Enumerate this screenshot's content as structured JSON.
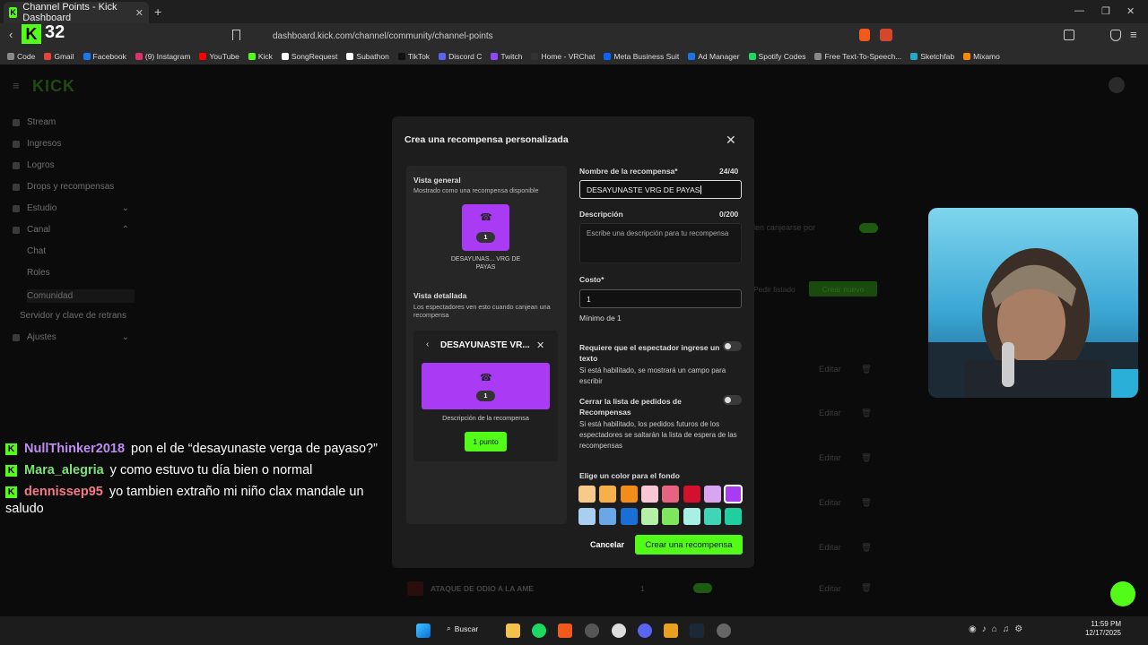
{
  "browser": {
    "tab_title": "Channel Points - Kick Dashboard",
    "url": "dashboard.kick.com/channel/community/channel-points",
    "kick_count": "32",
    "bookmarks": [
      "Code",
      "Gmail",
      "Facebook",
      "(9) Instagram",
      "YouTube",
      "Kick",
      "SongRequest",
      "Subathon",
      "TikTok",
      "Discord C",
      "Twitch",
      "Home - VRChat",
      "Meta Business Suit",
      "Ad Manager",
      "Spotify Codes",
      "Free Text-To-Speech...",
      "Sketchfab",
      "Mixamo"
    ]
  },
  "sidebar": {
    "brand": "KICK",
    "items": [
      "Stream",
      "Ingresos",
      "Logros",
      "Drops y recompensas",
      "Estudio",
      "Canal",
      "Chat",
      "Roles",
      "Comunidad",
      "Servidor y clave de retrans",
      "Ajustes"
    ]
  },
  "background": {
    "redeem_label": "len canjearse por",
    "list_button": "Pedir listado",
    "create_new": "Crear nuevo",
    "edit_label": "Editar",
    "last_row_name": "ATAQUE DE ODIO A LA AME",
    "last_row_cost": "1"
  },
  "modal": {
    "title": "Crea una recompensa personalizada",
    "overview_title": "Vista general",
    "overview_sub": "Mostrado como una recompensa disponible",
    "tile_cost": "1",
    "tile_name": "DESAYUNAS... VRG DE PAYAS",
    "detail_title": "Vista detallada",
    "detail_sub": "Los espectadores ven esto cuando canjean una recompensa",
    "detail_name": "DESAYUNASTE VR...",
    "detail_desc": "Descripción de la recompensa",
    "detail_points": "1 punto",
    "name_label": "Nombre de la recompensa*",
    "name_count": "24/40",
    "name_value": "DESAYUNASTE VRG DE PAYAS",
    "desc_label": "Descripción",
    "desc_count": "0/200",
    "desc_placeholder": "Escribe una descripción para tu recompensa",
    "cost_label": "Costo*",
    "cost_value": "1",
    "cost_min": "Mínimo de 1",
    "req_text_label": "Requiere que el espectador ingrese un texto",
    "req_text_sub": "Si está habilitado, se mostrará un campo para escribir",
    "close_list_label": "Cerrar la lista de pedidos de Recompensas",
    "close_list_sub": "Si está habilitado, los pedidos futuros de los espectadores se saltarán la lista de espera de las recompensas",
    "color_label": "Elige un color para el fondo",
    "colors_row1": [
      "#f8c98a",
      "#f5b04a",
      "#f28c1a",
      "#f9c7d4",
      "#e8637f",
      "#d2112f",
      "#d9a4f0",
      "#a93bf5"
    ],
    "colors_row2": [
      "#a9cff0",
      "#6aa7e6",
      "#1a6fd6",
      "#b5f0a8",
      "#7ee65c",
      "#a8efe4",
      "#3fd6b8",
      "#1fcfa0"
    ],
    "cancel": "Cancelar",
    "create": "Crear una recompensa"
  },
  "chat": [
    {
      "user": "NullThinker2018",
      "color": "#c08cf5",
      "msg": "pon el de “desayunaste verga de payaso?”"
    },
    {
      "user": "Mara_alegria",
      "color": "#7fe07a",
      "msg": "y como estuvo tu día bien o normal"
    },
    {
      "user": "dennissep95",
      "color": "#f47a8a",
      "msg": "yo tambien extraño mi niño clax mandale un saludo"
    }
  ],
  "taskbar": {
    "search": "Buscar",
    "time": "11:59 PM",
    "date": "12/17/2025"
  }
}
